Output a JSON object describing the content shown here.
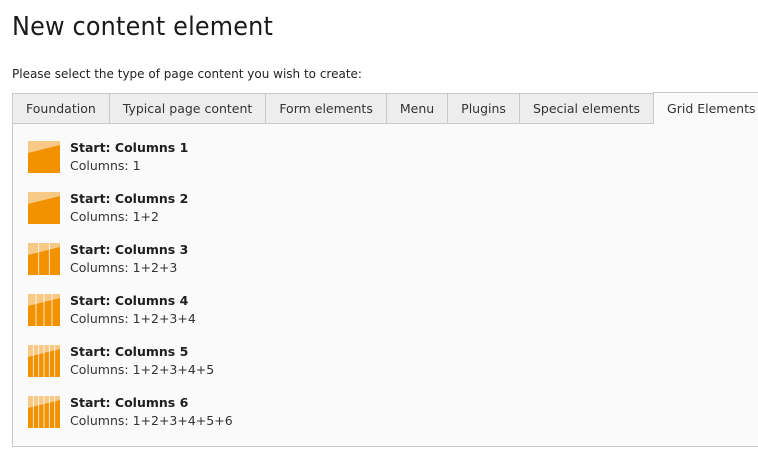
{
  "page": {
    "title": "New content element",
    "instruction": "Please select the type of page content you wish to create:"
  },
  "tabs": [
    {
      "label": "Foundation"
    },
    {
      "label": "Typical page content"
    },
    {
      "label": "Form elements"
    },
    {
      "label": "Menu"
    },
    {
      "label": "Plugins"
    },
    {
      "label": "Special elements"
    },
    {
      "label": "Grid Elements",
      "active": true
    }
  ],
  "elements": [
    {
      "title": "Start: Columns 1",
      "description": "Columns: 1",
      "icon": "grid-columns-1-icon",
      "columns": 1
    },
    {
      "title": "Start: Columns 2",
      "description": "Columns: 1+2",
      "icon": "grid-columns-2-icon",
      "columns": 2
    },
    {
      "title": "Start: Columns 3",
      "description": "Columns: 1+2+3",
      "icon": "grid-columns-3-icon",
      "columns": 3
    },
    {
      "title": "Start: Columns 4",
      "description": "Columns: 1+2+3+4",
      "icon": "grid-columns-4-icon",
      "columns": 4
    },
    {
      "title": "Start: Columns 5",
      "description": "Columns: 1+2+3+4+5",
      "icon": "grid-columns-5-icon",
      "columns": 5
    },
    {
      "title": "Start: Columns 6",
      "description": "Columns: 1+2+3+4+5+6",
      "icon": "grid-columns-6-icon",
      "columns": 6
    }
  ],
  "colors": {
    "icon_orange": "#f39200",
    "icon_light": "#f7c987",
    "icon_divider": "#ffffff"
  }
}
